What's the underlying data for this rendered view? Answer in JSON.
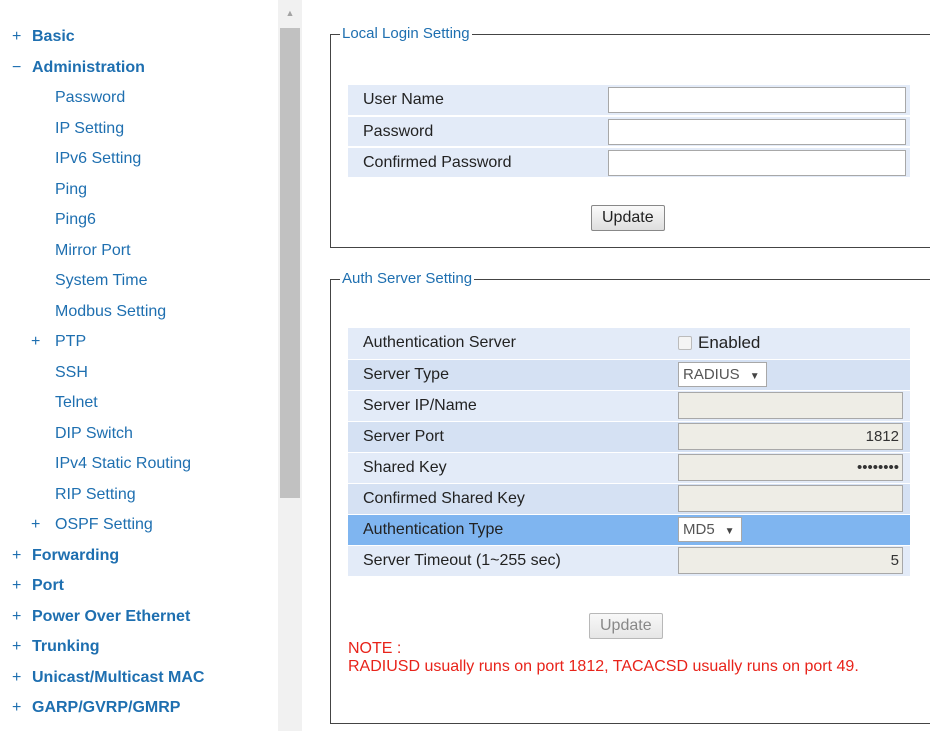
{
  "sidebar": {
    "items": [
      {
        "sign": "+",
        "label": "Basic"
      },
      {
        "sign": "−",
        "label": "Administration"
      },
      {
        "sign": "",
        "label": "Password"
      },
      {
        "sign": "",
        "label": "IP Setting"
      },
      {
        "sign": "",
        "label": "IPv6 Setting"
      },
      {
        "sign": "",
        "label": "Ping"
      },
      {
        "sign": "",
        "label": "Ping6"
      },
      {
        "sign": "",
        "label": "Mirror Port"
      },
      {
        "sign": "",
        "label": "System Time"
      },
      {
        "sign": "",
        "label": "Modbus Setting"
      },
      {
        "sign": "+",
        "label": "PTP"
      },
      {
        "sign": "",
        "label": "SSH"
      },
      {
        "sign": "",
        "label": "Telnet"
      },
      {
        "sign": "",
        "label": "DIP Switch"
      },
      {
        "sign": "",
        "label": "IPv4 Static Routing"
      },
      {
        "sign": "",
        "label": "RIP Setting"
      },
      {
        "sign": "+",
        "label": "OSPF Setting"
      },
      {
        "sign": "+",
        "label": "Forwarding"
      },
      {
        "sign": "+",
        "label": "Port"
      },
      {
        "sign": "+",
        "label": "Power Over Ethernet"
      },
      {
        "sign": "+",
        "label": "Trunking"
      },
      {
        "sign": "+",
        "label": "Unicast/Multicast MAC"
      },
      {
        "sign": "+",
        "label": "GARP/GVRP/GMRP"
      }
    ]
  },
  "local_login": {
    "legend": "Local Login Setting",
    "user_name_label": "User Name",
    "user_name_value": "",
    "password_label": "Password",
    "password_value": "",
    "confirmed_password_label": "Confirmed Password",
    "confirmed_password_value": "",
    "update_label": "Update"
  },
  "auth_server": {
    "legend": "Auth Server Setting",
    "auth_server_label": "Authentication Server",
    "enabled_label": "Enabled",
    "server_type_label": "Server Type",
    "server_type_value": "RADIUS",
    "server_ip_label": "Server IP/Name",
    "server_ip_value": "",
    "server_port_label": "Server Port",
    "server_port_value": "1812",
    "shared_key_label": "Shared Key",
    "shared_key_value": "••••••••",
    "confirmed_shared_key_label": "Confirmed Shared Key",
    "confirmed_shared_key_value": "",
    "auth_type_label": "Authentication Type",
    "auth_type_value": "MD5",
    "timeout_label": "Server Timeout (1~255 sec)",
    "timeout_value": "5",
    "update_label": "Update",
    "note_title": "NOTE :",
    "note_text": "RADIUSD usually runs on port 1812, TACACSD usually runs on port 49."
  },
  "colors": {
    "link": "#1e6fb0",
    "row_light": "#e3ebf8",
    "row_dark": "#d5e1f3",
    "row_highlight": "#7fb5f0",
    "note": "#e8231a"
  }
}
